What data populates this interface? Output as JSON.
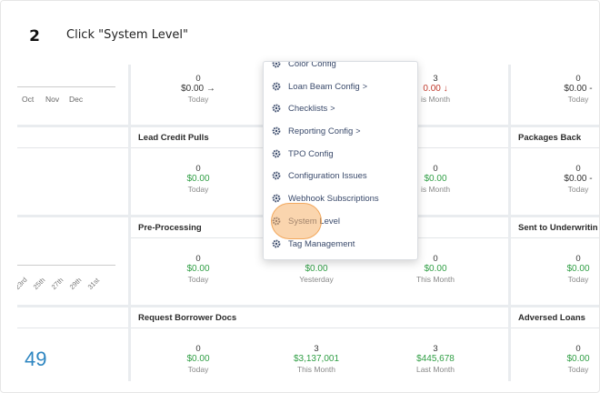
{
  "step": {
    "number": "2",
    "instruction": "Click \"System Level\""
  },
  "top_row": {
    "months": [
      "Oct",
      "Nov",
      "Dec"
    ],
    "stat_a": {
      "count": "0",
      "amount": "$0.00",
      "arrow": "→",
      "label": "Today"
    },
    "stat_b": {
      "count": "3",
      "amount": "0.00",
      "arrow": "↓",
      "label": "is Month"
    },
    "stat_c": {
      "count": "0",
      "amount": "$0.00 -",
      "label": "Today"
    }
  },
  "cards": {
    "lead_credit": {
      "title": "Lead Credit Pulls",
      "stat1": {
        "count": "0",
        "amount": "$0.00",
        "label": "Today"
      },
      "stat2": {
        "count": "0",
        "amount": "$0.00",
        "label": "is Month"
      }
    },
    "packages_back": {
      "title": "Packages Back",
      "stat1": {
        "count": "0",
        "amount": "$0.00 -",
        "label": "Today"
      }
    },
    "pre_processing": {
      "title": "Pre-Processing",
      "stat1": {
        "count": "0",
        "amount": "$0.00",
        "label": "Today"
      },
      "stat2": {
        "count": "",
        "amount": "$0.00",
        "label": "Yesterday"
      },
      "stat3": {
        "count": "0",
        "amount": "$0.00",
        "label": "This Month"
      }
    },
    "sent_uw": {
      "title": "Sent to Underwritin",
      "stat1": {
        "count": "0",
        "amount": "$0.00",
        "label": "Today"
      }
    },
    "request_docs": {
      "title": "Request Borrower Docs",
      "stat1": {
        "count": "0",
        "amount": "$0.00",
        "label": "Today"
      },
      "stat2": {
        "count": "3",
        "amount": "$3,137,001",
        "label": "This Month"
      },
      "stat3": {
        "count": "3",
        "amount": "$445,678",
        "label": "Last Month"
      }
    },
    "adversed": {
      "title": "Adversed Loans",
      "stat1": {
        "count": "0",
        "amount": "$0.00",
        "label": "Today"
      }
    }
  },
  "date_ticks": [
    "23rd",
    "25th",
    "27th",
    "29th",
    "31st"
  ],
  "left_big_number": "49",
  "menu": {
    "partial_top": "Color Config",
    "items": [
      {
        "label": "Loan Beam Config",
        "chevron": ">"
      },
      {
        "label": "Checklists",
        "chevron": ">"
      },
      {
        "label": "Reporting Config",
        "chevron": ">"
      },
      {
        "label": "TPO Config",
        "chevron": ""
      },
      {
        "label": "Configuration Issues",
        "chevron": ""
      },
      {
        "label": "Webhook Subscriptions",
        "chevron": ""
      },
      {
        "label": "System Level",
        "chevron": ""
      },
      {
        "label": "Tag Management",
        "chevron": ""
      }
    ]
  },
  "colors": {
    "accent_blue": "#2e86c1",
    "green": "#2f9e44",
    "red": "#c0392b",
    "highlight": "#f6b26b"
  }
}
